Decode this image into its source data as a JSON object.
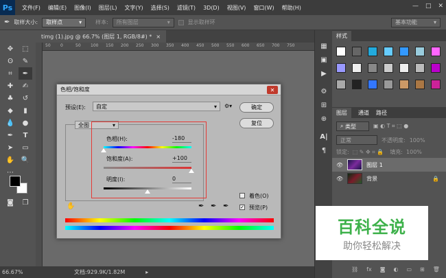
{
  "menubar": {
    "logo": "Ps",
    "items": [
      "文件(F)",
      "编辑(E)",
      "图像(I)",
      "图层(L)",
      "文字(Y)",
      "选择(S)",
      "滤镜(T)",
      "3D(D)",
      "视图(V)",
      "窗口(W)",
      "帮助(H)"
    ],
    "window_controls": [
      "—",
      "□",
      "✕"
    ]
  },
  "optionsbar": {
    "sample_size_label": "取样大小:",
    "sample_size_value": "取样点",
    "sample_label": "样本:",
    "sample_value": "所有图层",
    "show_ring_label": "显示取样环",
    "workspace": "基本功能"
  },
  "document": {
    "tab_title": "timg (1).jpg @ 66.7% (图层 1, RGB/8#) *",
    "tab_close": "×",
    "ruler_ticks": [
      "50",
      "0",
      "50",
      "100",
      "150",
      "200",
      "250",
      "300",
      "350",
      "400",
      "450",
      "500",
      "550",
      "600",
      "650",
      "700",
      "750"
    ],
    "zoom": "66.67%",
    "doc_info": "文档:929.9K/1.82M"
  },
  "dialog": {
    "title": "色相/饱和度",
    "preset_label": "预设(E):",
    "preset_value": "自定",
    "channel_value": "全图",
    "hue_label": "色相(H):",
    "hue_value": "-180",
    "hue_level": 0,
    "saturation_label": "饱和度(A):",
    "saturation_value": "+100",
    "saturation_level": 1,
    "lightness_label": "明度(I):",
    "lightness_value": "0",
    "lightness_level": 0.5,
    "ok_label": "确定",
    "reset_label": "复位",
    "colorize_label": "着色(O)",
    "colorize_checked": false,
    "preview_label": "预览(P)",
    "preview_checked": true
  },
  "styles_panel": {
    "title": "样式"
  },
  "layers_panel": {
    "tabs": [
      "图层",
      "通道",
      "路径"
    ],
    "filter_kind": "类型",
    "blend_mode": "正常",
    "opacity_label": "不透明度:",
    "opacity_value": "100%",
    "lock_label": "锁定:",
    "fill_label": "填充:",
    "fill_value": "100%",
    "layers": [
      {
        "name": "图层 1"
      },
      {
        "name": "背景"
      }
    ]
  },
  "watermark": {
    "line1": "百科全说",
    "line2": "助你轻松解决"
  },
  "colors": {
    "accent": "#31a8ff",
    "wm_green": "#3db14a",
    "highlight": "#e53935"
  }
}
